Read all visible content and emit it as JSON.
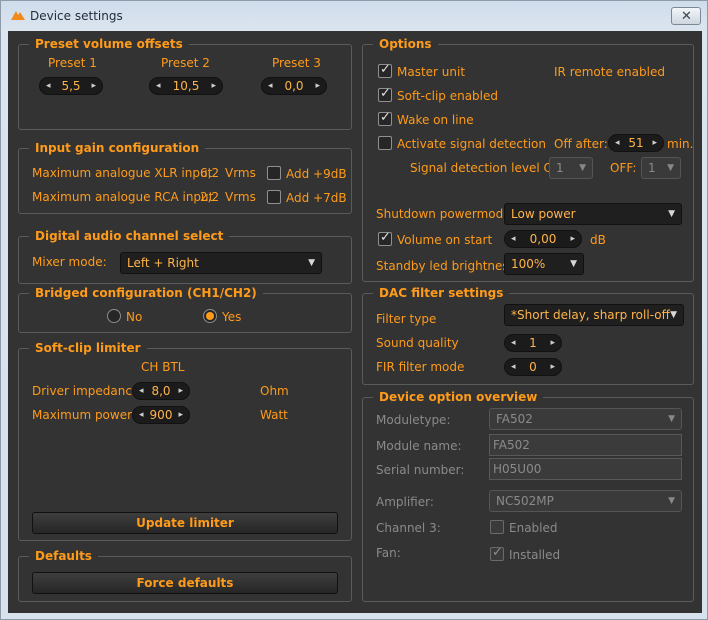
{
  "window": {
    "title": "Device settings",
    "close_glyph": "✕"
  },
  "colors": {
    "accent": "#ff9b1a",
    "background": "#333333",
    "disabled": "#8a8a8a"
  },
  "preset_volume": {
    "title": "Preset volume offsets",
    "presets": [
      {
        "label": "Preset 1",
        "value": "5,5"
      },
      {
        "label": "Preset 2",
        "value": "10,5"
      },
      {
        "label": "Preset 3",
        "value": "0,0"
      }
    ]
  },
  "input_gain": {
    "title": "Input gain configuration",
    "xlr": {
      "label": "Maximum analogue XLR input",
      "value": "6,2",
      "unit": "Vrms",
      "add_label": "Add +9dB",
      "checked": false
    },
    "rca": {
      "label": "Maximum analogue RCA input",
      "value": "2,2",
      "unit": "Vrms",
      "add_label": "Add +7dB",
      "checked": false
    }
  },
  "digital_audio": {
    "title": "Digital audio channel select",
    "mixer_label": "Mixer mode:",
    "mixer_value": "Left + Right"
  },
  "bridged": {
    "title": "Bridged configuration (CH1/CH2)",
    "no_label": "No",
    "yes_label": "Yes",
    "selected": "Yes"
  },
  "softclip": {
    "title": "Soft-clip limiter",
    "column_header": "CH BTL",
    "impedance": {
      "label": "Driver impedance",
      "value": "8,0",
      "unit": "Ohm"
    },
    "power": {
      "label": "Maximum power",
      "value": "900",
      "unit": "Watt"
    },
    "update_button": "Update limiter"
  },
  "defaults": {
    "title": "Defaults",
    "force_button": "Force defaults"
  },
  "options": {
    "title": "Options",
    "master_unit": {
      "label": "Master unit",
      "checked": true
    },
    "ir_remote": "IR remote enabled",
    "softclip_enabled": {
      "label": "Soft-clip enabled",
      "checked": true
    },
    "wake_on_line": {
      "label": "Wake on line",
      "checked": true
    },
    "signal_detection": {
      "label": "Activate signal detection",
      "checked": false
    },
    "off_after_label": "Off after:",
    "off_after_value": "51",
    "off_after_unit": "min.",
    "detection_level_label": "Signal detection level ON:",
    "detection_on_value": "1",
    "detection_off_label": "OFF:",
    "detection_off_value": "1",
    "shutdown_label": "Shutdown powermode:",
    "shutdown_value": "Low power",
    "volume_on_start": {
      "label": "Volume on start",
      "checked": true,
      "value": "0,00",
      "unit": "dB"
    },
    "standby_led_label": "Standby led brightness",
    "standby_led_value": "100%"
  },
  "dac_filter": {
    "title": "DAC filter settings",
    "filter_type_label": "Filter type",
    "filter_type_value": "*Short delay, sharp roll-off",
    "sound_quality_label": "Sound quality",
    "sound_quality_value": "1",
    "fir_label": "FIR filter mode",
    "fir_value": "0"
  },
  "device_overview": {
    "title": "Device option overview",
    "moduletype_label": "Moduletype:",
    "moduletype_value": "FA502",
    "module_name_label": "Module name:",
    "module_name_value": "FA502",
    "serial_label": "Serial number:",
    "serial_value": "H05U00",
    "amplifier_label": "Amplifier:",
    "amplifier_value": "NC502MP",
    "channel3_label": "Channel 3:",
    "channel3_option": "Enabled",
    "channel3_checked": false,
    "fan_label": "Fan:",
    "fan_option": "Installed",
    "fan_checked": true
  }
}
